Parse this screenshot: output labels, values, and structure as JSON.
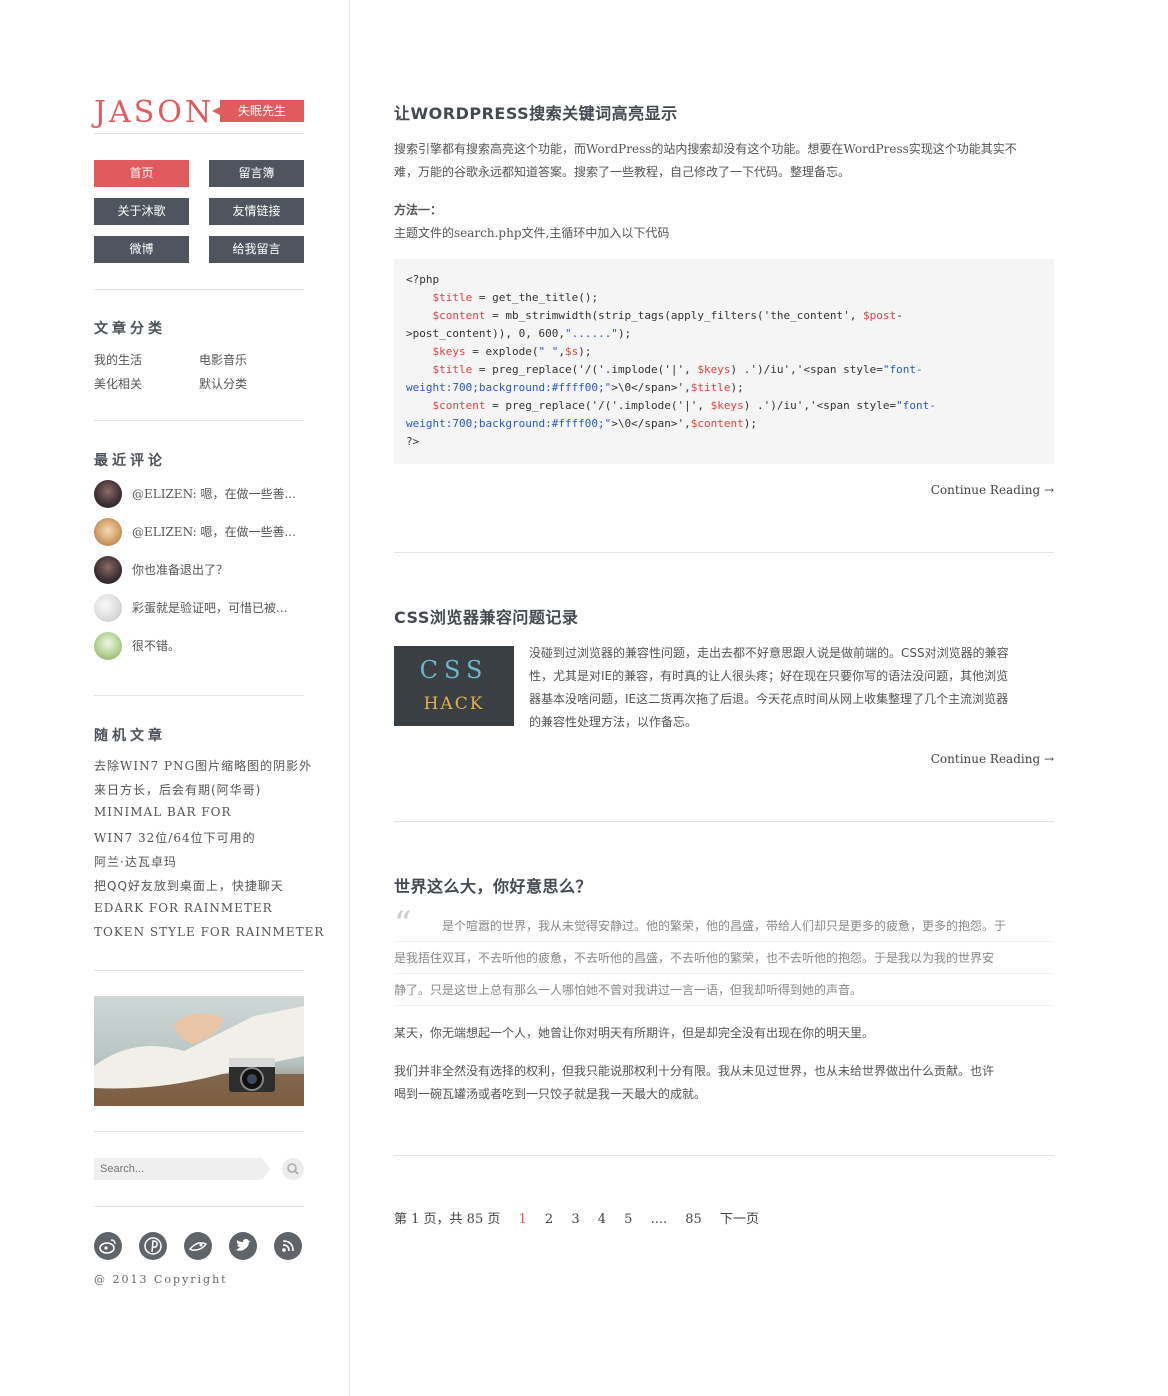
{
  "site": {
    "name": "JASON",
    "tagline": "失眠先生"
  },
  "nav": [
    {
      "label": "首页",
      "active": true
    },
    {
      "label": "留言簿"
    },
    {
      "label": "关于沐歌"
    },
    {
      "label": "友情链接"
    },
    {
      "label": "微博"
    },
    {
      "label": "给我留言"
    }
  ],
  "categories": {
    "title": "文章分类",
    "items": [
      "我的生活",
      "电影音乐",
      "美化相关",
      "默认分类"
    ]
  },
  "comments": {
    "title": "最近评论",
    "items": [
      {
        "text": "@ELIZEN: 嗯，在做一些善...",
        "avatar": "dark"
      },
      {
        "text": "@ELIZEN: 嗯，在做一些善...",
        "avatar": "tan"
      },
      {
        "text": "你也准备退出了？",
        "avatar": "dark"
      },
      {
        "text": "彩蛋就是验证吧，可惜已被...",
        "avatar": "light"
      },
      {
        "text": "很不错。",
        "avatar": "green"
      }
    ]
  },
  "random": {
    "title": "随机文章",
    "items": [
      "去除WIN7 PNG图片缩略图的阴影外",
      "来日方长，后会有期(阿华哥)",
      "MINIMAL BAR FOR",
      "WIN7 32位/64位下可用的",
      "阿兰·达瓦卓玛",
      "把QQ好友放到桌面上，快捷聊天",
      "EDARK FOR RAINMETER",
      "TOKEN STYLE FOR RAINMETER"
    ]
  },
  "search": {
    "placeholder": "Search..."
  },
  "social_icons": [
    "weibo-icon",
    "pinterest-icon",
    "douban-icon",
    "twitter-icon",
    "rss-icon"
  ],
  "copyright": "@ 2013 Copyright",
  "posts": [
    {
      "title": "让WORDPRESS搜索关键词高亮显示",
      "para1_line1": "搜索引擎都有搜索高亮这个功能，而WordPress的站内搜索却没有这个功能。想要在WordPress实现这个功能其实不",
      "para1_line2": "难，万能的谷歌永远都知道答案。搜索了一些教程，自己修改了一下代码。整理备忘。",
      "method": "方法一：",
      "method_desc": "主题文件的search.php文件,主循环中加入以下代码",
      "continue": "Continue Reading →"
    },
    {
      "title": "CSS浏览器兼容问题记录",
      "thumb_line1": "CSS",
      "thumb_line2": "HACK",
      "lines": [
        "没碰到过浏览器的兼容性问题，走出去都不好意思跟人说是做前端的。CSS对浏览器的兼容",
        "性，尤其是对IE的兼容，有时真的让人很头疼；好在现在只要你写的语法没问题，其他浏览",
        "器基本没啥问题，IE这二货再次拖了后退。今天花点时间从网上收集整理了几个主流浏览器",
        "的兼容性处理方法，以作备忘。"
      ],
      "continue": "Continue Reading →"
    },
    {
      "title": "世界这么大，你好意思么？",
      "quote_mark": "“",
      "quote_lines": [
        "是个喧嚣的世界，我从未觉得安静过。他的繁荣，他的昌盛，带给人们却只是更多的疲惫，更多的抱怨。于",
        "是我捂住双耳，不去听他的疲惫，不去听他的昌盛，不去听他的繁荣，也不去听他的抱怨。于是我以为我的世界安",
        "静了。只是这世上总有那么一人哪怕她不曾对我讲过一言一语，但我却听得到她的声音。"
      ],
      "para1": "某天，你无端想起一个人，她曾让你对明天有所期许，但是却完全没有出现在你的明天里。",
      "para2_line1": "我们并非全然没有选择的权利，但我只能说那权利十分有限。我从未见过世界，也从未给世界做出什么贡献。也许",
      "para2_line2": "喝到一碗瓦罐汤或者吃到一只饺子就是我一天最大的成就。"
    }
  ],
  "pagination": {
    "summary": "第 1 页，共 85 页",
    "pages": [
      "1",
      "2",
      "3",
      "4",
      "5",
      "....",
      "85"
    ],
    "current": "1",
    "next": "下一页"
  },
  "colors": {
    "accent": "#e15a5e",
    "nav": "#4e555e",
    "code_bg": "#f5f5f5"
  }
}
